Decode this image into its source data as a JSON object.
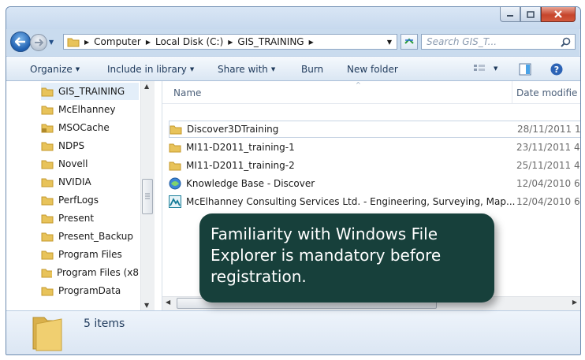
{
  "window": {
    "caption_buttons": {
      "minimize_icon": "minimize-icon",
      "maximize_icon": "maximize-icon",
      "close_icon": "close-icon"
    }
  },
  "address": {
    "breadcrumbs": [
      "Computer",
      "Local Disk (C:)",
      "GIS_TRAINING"
    ],
    "search_placeholder": "Search GIS_T..."
  },
  "toolbar": {
    "organize": "Organize",
    "include_in_library": "Include in library",
    "share_with": "Share with",
    "burn": "Burn",
    "new_folder": "New folder"
  },
  "nav_pane": {
    "items": [
      {
        "label": "GIS_TRAINING",
        "icon": "folder-icon",
        "selected": true
      },
      {
        "label": "McElhanney",
        "icon": "folder-icon"
      },
      {
        "label": "MSOCache",
        "icon": "locked-folder-icon"
      },
      {
        "label": "NDPS",
        "icon": "folder-icon"
      },
      {
        "label": "Novell",
        "icon": "folder-icon"
      },
      {
        "label": "NVIDIA",
        "icon": "folder-icon"
      },
      {
        "label": "PerfLogs",
        "icon": "folder-icon"
      },
      {
        "label": "Present",
        "icon": "folder-icon"
      },
      {
        "label": "Present_Backup",
        "icon": "folder-icon"
      },
      {
        "label": "Program Files",
        "icon": "folder-icon"
      },
      {
        "label": "Program Files (x8",
        "icon": "folder-icon"
      },
      {
        "label": "ProgramData",
        "icon": "folder-icon"
      }
    ]
  },
  "file_list": {
    "columns": {
      "name": "Name",
      "date": "Date modifie"
    },
    "rows": [
      {
        "name": "Discover3DTraining",
        "date": "28/11/2011 1",
        "icon": "folder-icon",
        "selected": true
      },
      {
        "name": "MI11-D2011_training-1",
        "date": "23/11/2011 4",
        "icon": "folder-icon"
      },
      {
        "name": "MI11-D2011_training-2",
        "date": "25/11/2011 4",
        "icon": "folder-icon"
      },
      {
        "name": "Knowledge Base - Discover",
        "date": "12/04/2010 6",
        "icon": "web-shortcut-icon"
      },
      {
        "name": "McElhanney Consulting Services Ltd. - Engineering, Surveying, Map...",
        "date": "12/04/2010 6",
        "icon": "company-shortcut-icon"
      }
    ]
  },
  "status": {
    "item_count": "5 items"
  },
  "callout": {
    "lines": [
      "Familiarity with Windows File",
      "Explorer is mandatory before",
      "registration."
    ]
  },
  "colors": {
    "callout_bg": "#17403b",
    "folder": "#e8c35a",
    "window_frame": "#c9dbee"
  }
}
